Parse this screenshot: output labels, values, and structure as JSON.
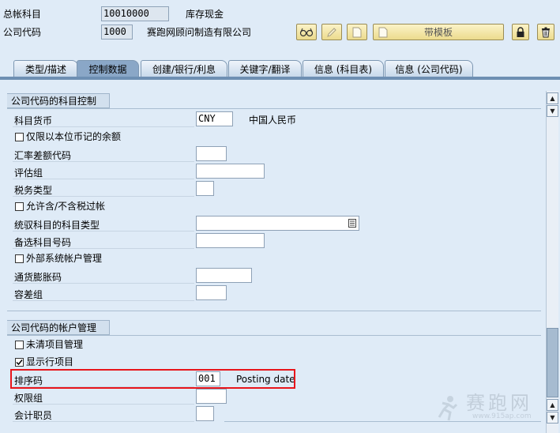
{
  "header": {
    "gl_account_label": "总帐科目",
    "gl_account_value": "10010000",
    "gl_account_desc": "库存现金",
    "company_code_label": "公司代码",
    "company_code_value": "1000",
    "company_code_desc": "赛跑网顾问制造有限公司"
  },
  "toolbar": {
    "glasses_icon": "display-change-icon",
    "pencil_icon": "edit-icon",
    "page_icon": "create-icon",
    "template_label": "带模板",
    "lock_icon": "lock-icon",
    "trash_icon": "delete-icon"
  },
  "tabs": [
    {
      "label": "类型/描述"
    },
    {
      "label": "控制数据"
    },
    {
      "label": "创建/银行/利息"
    },
    {
      "label": "关键字/翻译"
    },
    {
      "label": "信息 (科目表)"
    },
    {
      "label": "信息 (公司代码)"
    }
  ],
  "group1": {
    "title": "公司代码的科目控制",
    "currency_label": "科目货币",
    "currency_value": "CNY",
    "currency_desc": "中国人民币",
    "local_only_label": "仅限以本位币记的余额",
    "exch_diff_label": "汇率差额代码",
    "valuation_label": "评估组",
    "tax_cat_label": "税务类型",
    "allow_tax_label": "允许含/不含税过帐",
    "recon_type_label": "统驭科目的科目类型",
    "alt_acct_label": "备选科目号码",
    "ext_mgmt_label": "外部系统帐户管理",
    "inflation_label": "通货膨胀码",
    "tolerance_label": "容差组"
  },
  "group2": {
    "title": "公司代码的帐户管理",
    "open_item_label": "未清项目管理",
    "line_item_label": "显示行项目",
    "sort_key_label": "排序码",
    "sort_key_value": "001",
    "sort_key_desc": "Posting date",
    "auth_group_label": "权限组",
    "clerk_label": "会计职员"
  },
  "checkboxes": {
    "local_only": false,
    "allow_tax": false,
    "ext_mgmt": false,
    "open_item": false,
    "line_item": true
  },
  "colors": {
    "highlight_box": "#e8151b",
    "active_tab": "#8aa7c7",
    "button": "#f2e4a6"
  },
  "watermark": {
    "text": "赛跑网",
    "url": "www.915ap.com"
  }
}
